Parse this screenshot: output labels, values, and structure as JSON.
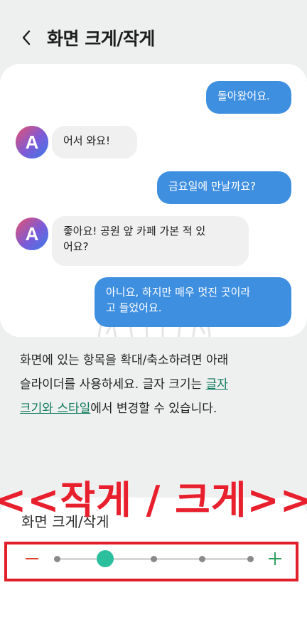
{
  "header": {
    "back_icon": "chevron-left-icon",
    "title": "화면 크게/작게"
  },
  "chat": {
    "avatar_letter": "A",
    "messages": [
      {
        "from": "me",
        "text": "돌아왔어요."
      },
      {
        "from": "them",
        "text": "어서 와요!"
      },
      {
        "from": "me",
        "text": "금요일에 만날까요?"
      },
      {
        "from": "them",
        "line1": "좋아요! 공원 앞 카페 가본 적 있",
        "line2": "어요?"
      },
      {
        "from": "me",
        "line1": "아니요, 하지만 매우 멋진 곳이라",
        "line2": "고 들었어요."
      }
    ]
  },
  "description": {
    "line1": "화면에 있는 항목을 확대/축소하려면 아래",
    "line2_pre": "슬라이더를 사용하세요. 글자 크기는 ",
    "link_part1": "글자",
    "link_part2": "크기와 스타일",
    "line3_post": "에서 변경할 수 있습니다."
  },
  "annotation": {
    "text": "<<작게 / 크게>>",
    "color": "#e8202e"
  },
  "zoom": {
    "label": "화면 크게/작게",
    "minus_icon": "minus-icon",
    "plus_icon": "plus-icon",
    "steps": 5,
    "selected_step": 1
  },
  "colors": {
    "accent": "#2bbf9e",
    "sent_bubble": "#3f8fe0",
    "received_bubble": "#f0f0f1",
    "link": "#0e7a5c",
    "annotation_red": "#e11f2a"
  }
}
